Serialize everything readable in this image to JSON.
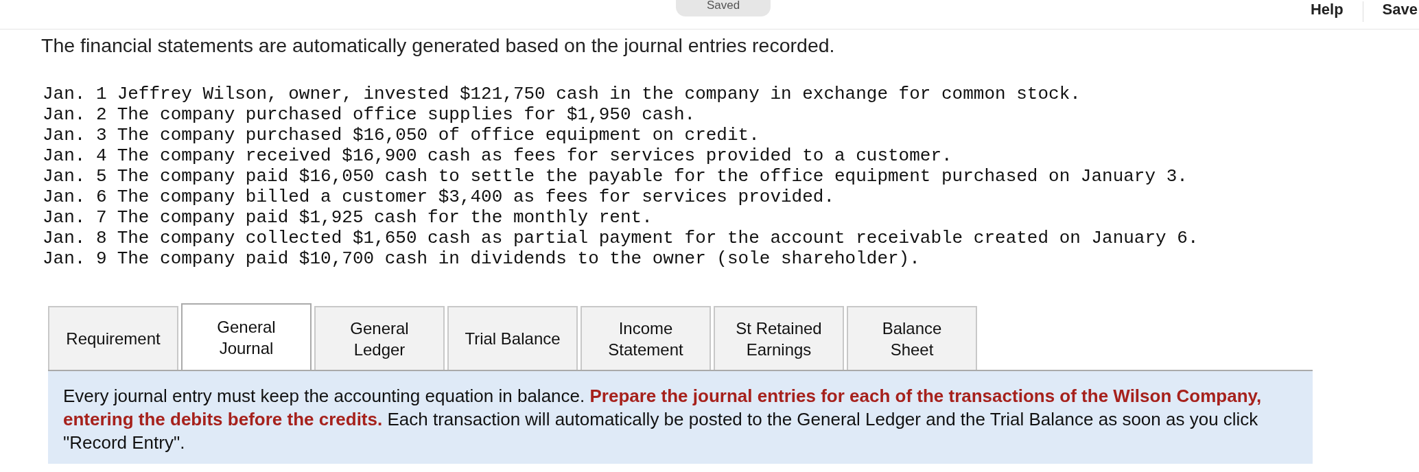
{
  "header": {
    "status": "Saved",
    "links": [
      "Help",
      "Save"
    ]
  },
  "intro": "The financial statements are automatically generated based on the journal entries recorded.",
  "transactions": [
    {
      "date": "Jan. 1",
      "text": "Jeffrey Wilson, owner, invested $121,750 cash in the company in exchange for common stock."
    },
    {
      "date": "Jan. 2",
      "text": "The company purchased office supplies for $1,950 cash."
    },
    {
      "date": "Jan. 3",
      "text": "The company purchased $16,050 of office equipment on credit."
    },
    {
      "date": "Jan. 4",
      "text": "The company received $16,900 cash as fees for services provided to a customer."
    },
    {
      "date": "Jan. 5",
      "text": "The company paid $16,050 cash to settle the payable for the office equipment purchased on January 3."
    },
    {
      "date": "Jan. 6",
      "text": "The company billed a customer $3,400 as fees for services provided."
    },
    {
      "date": "Jan. 7",
      "text": "The company paid $1,925 cash for the monthly rent."
    },
    {
      "date": "Jan. 8",
      "text": "The company collected $1,650 cash as partial payment for the account receivable created on January 6."
    },
    {
      "date": "Jan. 9",
      "text": "The company paid $10,700 cash in dividends to the owner (sole shareholder)."
    }
  ],
  "tabs": [
    {
      "label": "Requirement",
      "selected": false
    },
    {
      "label": "General Journal",
      "selected": true
    },
    {
      "label": "General Ledger",
      "selected": false
    },
    {
      "label": "Trial Balance",
      "selected": false
    },
    {
      "label": "Income Statement",
      "selected": false
    },
    {
      "label": "St Retained Earnings",
      "selected": false
    },
    {
      "label": "Balance Sheet",
      "selected": false
    }
  ],
  "instructions": "Every journal entry must keep the accounting equation in balance. **Prepare the journal entries for each of the transactions of the Wilson Company, entering the debits before the credits.** Each transaction will automatically be posted to the General Ledger and the Trial Balance as soon as you click \"Record Entry\"."
}
